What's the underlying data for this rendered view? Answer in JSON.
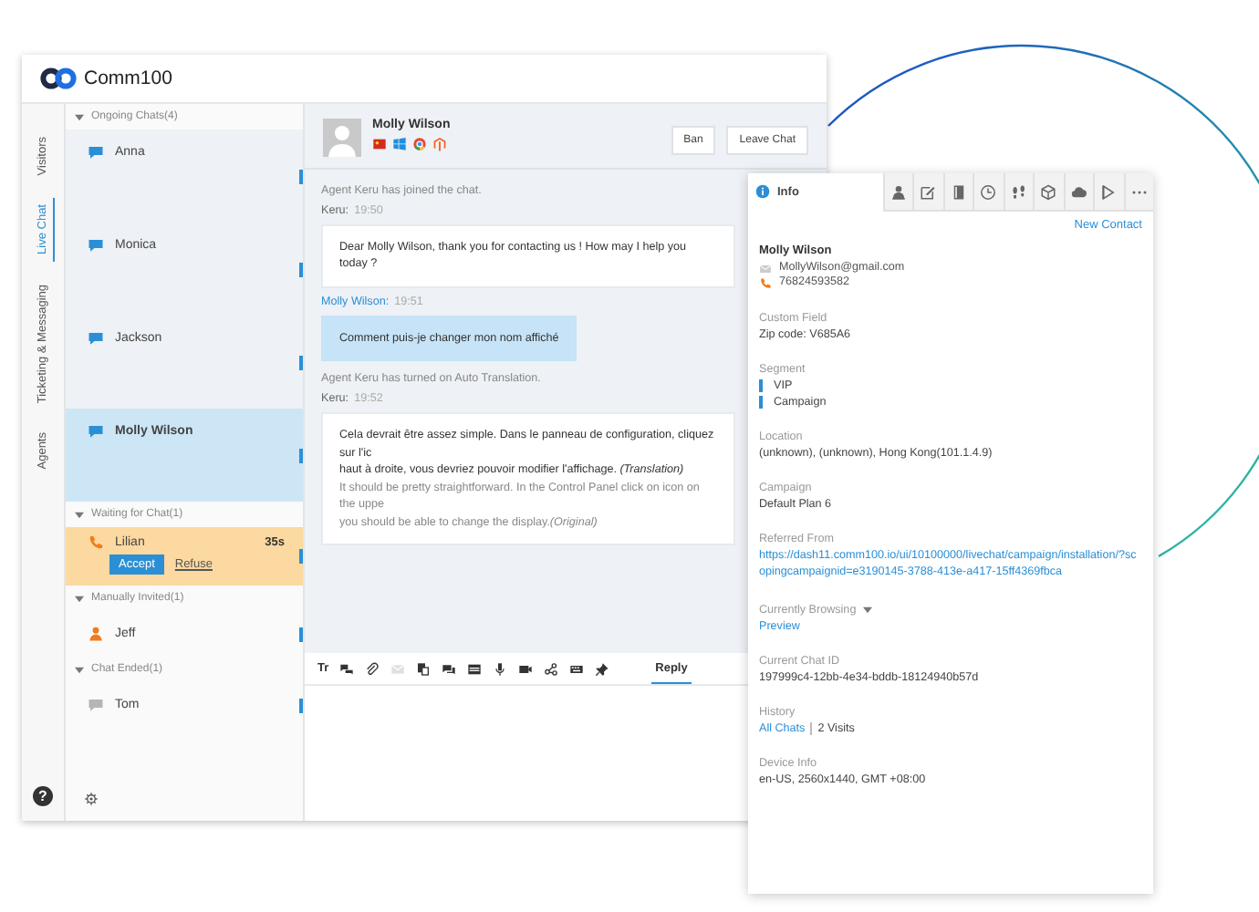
{
  "app": {
    "title": "Comm100"
  },
  "rail_tabs": [
    {
      "label": "Visitors",
      "selected": false
    },
    {
      "label": "Live Chat",
      "selected": true
    },
    {
      "label": "Ticketing & Messaging",
      "selected": false
    },
    {
      "label": "Agents",
      "selected": false
    }
  ],
  "help_label": "?",
  "chat_sections": [
    {
      "title": "Ongoing Chats(4)",
      "expanded": true,
      "items": [
        {
          "name": "Anna",
          "kind": "chat",
          "selected": false
        },
        {
          "name": "Monica",
          "kind": "chat",
          "selected": false
        },
        {
          "name": "Jackson",
          "kind": "chat",
          "selected": false
        },
        {
          "name": "Molly Wilson",
          "kind": "chat",
          "selected": true
        }
      ]
    },
    {
      "title": "Waiting for Chat(1)",
      "expanded": true,
      "items": [
        {
          "name": "Lilian",
          "kind": "waiting",
          "selected": false,
          "accept": "Accept",
          "refuse": "Refuse",
          "timer": "35s"
        }
      ]
    },
    {
      "title": "Manually Invited(1)",
      "expanded": true,
      "items": [
        {
          "name": "Jeff",
          "kind": "invited",
          "selected": false
        }
      ]
    },
    {
      "title": "Chat Ended(1)",
      "expanded": true,
      "items": [
        {
          "name": "Tom",
          "kind": "ended",
          "selected": false
        }
      ]
    }
  ],
  "visitor": {
    "name": "Molly Wilson",
    "badges": [
      {
        "kind": "flag"
      },
      {
        "kind": "windows"
      },
      {
        "kind": "chrome"
      },
      {
        "kind": "magento"
      }
    ]
  },
  "header_buttons": [
    "Ban",
    "Leave Chat"
  ],
  "messages": [
    {
      "kind": "system",
      "text": "Agent Keru has joined the chat."
    },
    {
      "kind": "agent",
      "sender": "Keru:",
      "time": "19:50",
      "lines": [
        {
          "kind": "plain",
          "text": "Dear Molly Wilson, thank you for contacting us ! How may I help you today ?"
        }
      ]
    },
    {
      "kind": "visitor",
      "sender": "Molly Wilson:",
      "time": "19:51",
      "lines": [
        {
          "kind": "plain",
          "text": "Comment puis-je changer mon nom affiché"
        }
      ]
    },
    {
      "kind": "system",
      "text": "Agent Keru has turned on Auto Translation."
    },
    {
      "kind": "agent",
      "sender": "Keru:",
      "time": "19:52",
      "lines": [
        {
          "kind": "translated",
          "text": "Cela devrait être assez simple. Dans le panneau de configuration, cliquez sur l'ic"
        },
        {
          "kind": "translated",
          "text": "haut à droite, vous devriez pouvoir modifier l'affichage. *(Translation)*"
        },
        {
          "kind": "original",
          "text": "It should be pretty straightforward. In the Control Panel click on icon on the uppe"
        },
        {
          "kind": "original",
          "text": "you should be able to change the display.*(Original)*"
        }
      ]
    }
  ],
  "composer_tools": [
    {
      "kind": "format",
      "label": "Tr",
      "disabled": false
    },
    {
      "kind": "canned",
      "disabled": false
    },
    {
      "kind": "attach",
      "disabled": false
    },
    {
      "kind": "email",
      "disabled": true
    },
    {
      "kind": "copy",
      "disabled": false
    },
    {
      "kind": "chats",
      "disabled": false
    },
    {
      "kind": "card",
      "disabled": false
    },
    {
      "kind": "mic",
      "disabled": false
    },
    {
      "kind": "video",
      "disabled": false
    },
    {
      "kind": "share",
      "disabled": false
    },
    {
      "kind": "grid",
      "disabled": false
    },
    {
      "kind": "pin",
      "disabled": false
    }
  ],
  "composer_tab": {
    "label": "Reply",
    "selected": true
  },
  "info_panel": {
    "tabs": [
      {
        "kind": "info",
        "label": "Info",
        "selected": true
      },
      {
        "kind": "agent",
        "selected": false
      },
      {
        "kind": "note",
        "selected": false
      },
      {
        "kind": "book",
        "selected": false
      },
      {
        "kind": "clock",
        "selected": false
      },
      {
        "kind": "steps",
        "selected": false
      },
      {
        "kind": "cube",
        "selected": false
      },
      {
        "kind": "cloud",
        "selected": false
      },
      {
        "kind": "play",
        "selected": false
      },
      {
        "kind": "more",
        "selected": false
      }
    ],
    "new_contact": "New Contact",
    "name": "Molly Wilson",
    "email": "MollyWilson@gmail.com",
    "phone": "76824593582",
    "sections": [
      {
        "kind": "text",
        "label": "Custom Field",
        "value": "Zip code: V685A6"
      },
      {
        "kind": "segments",
        "label": "Segment",
        "items": [
          {
            "text": "VIP",
            "color": "#2b8fd6"
          },
          {
            "text": "Campaign",
            "color": "#2b8fd6"
          }
        ]
      },
      {
        "kind": "text",
        "label": "Location",
        "value": "(unknown), (unknown), Hong Kong(101.1.4.9)"
      },
      {
        "kind": "text",
        "label": "Campaign",
        "value": "Default Plan 6"
      },
      {
        "kind": "link",
        "label": "Referred From",
        "value": "https://dash11.comm100.io/ui/10100000/livechat/campaign/installation/?scopingcampaignid=e3190145-3788-413e-a417-15ff4369fbca"
      },
      {
        "kind": "dropdown",
        "label": "Currently Browsing",
        "value": "Preview",
        "expanded": false
      },
      {
        "kind": "text",
        "label": "Current Chat ID",
        "value": "197999c4-12bb-4e34-bddb-18124940b57d"
      },
      {
        "kind": "history",
        "label": "History",
        "link": "All Chats",
        "value": "2 Visits"
      },
      {
        "kind": "text",
        "label": "Device Info",
        "value": "en-US, 2560x1440, GMT +08:00"
      }
    ]
  }
}
